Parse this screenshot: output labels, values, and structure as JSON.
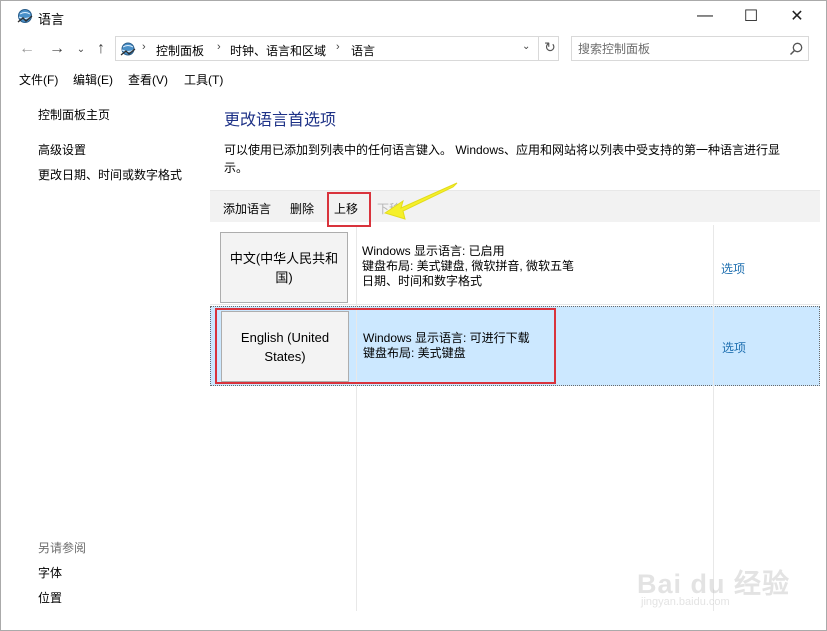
{
  "window": {
    "title": "语言",
    "minimize_symbol": "—",
    "maximize_symbol": "☐",
    "close_symbol": "✕"
  },
  "nav": {
    "back_symbol": "←",
    "forward_symbol": "→",
    "recent_symbol": "⌄",
    "up_symbol": "↑",
    "breadcrumb": [
      "控制面板",
      "时钟、语言和区域",
      "语言"
    ],
    "breadcrumb_separator": "›",
    "dropdown_symbol": "⌄",
    "refresh_symbol": "↻",
    "search_placeholder": "搜索控制面板"
  },
  "menu": [
    "文件(F)",
    "编辑(E)",
    "查看(V)",
    "工具(T)"
  ],
  "sidebar": {
    "home": "控制面板主页",
    "links": [
      "高级设置",
      "更改日期、时间或数字格式"
    ],
    "see_also_heading": "另请参阅",
    "see_also_links": [
      "字体",
      "位置"
    ]
  },
  "main": {
    "title": "更改语言首选项",
    "description": "可以使用已添加到列表中的任何语言键入。 Windows、应用和网站将以列表中受支持的第一种语言进行显示。",
    "toolbar": {
      "add": "添加语言",
      "remove": "删除",
      "move_up": "上移",
      "move_down": "下移"
    },
    "languages": [
      {
        "name": "中文(中华人民共和国)",
        "display": "Windows 显示语言: 已启用",
        "keyboard": "键盘布局: 美式键盘, 微软拼音, 微软五笔",
        "format": "日期、时间和数字格式",
        "options": "选项"
      },
      {
        "name": "English (United States)",
        "display": "Windows 显示语言: 可进行下载",
        "keyboard": "键盘布局: 美式键盘",
        "format": "",
        "options": "选项"
      }
    ]
  },
  "watermark": {
    "main": "Bai du 经验",
    "sub": "jingyan.baidu.com"
  },
  "colors": {
    "selected_row": "#cce8ff",
    "highlight_box": "#d9333c",
    "annotation_arrow": "#f5f02a",
    "link": "#1e6fb0",
    "title": "#1e3287"
  },
  "icons": {
    "title": "control-panel-globe-icon",
    "address": "control-panel-globe-icon",
    "search": "search-icon"
  }
}
